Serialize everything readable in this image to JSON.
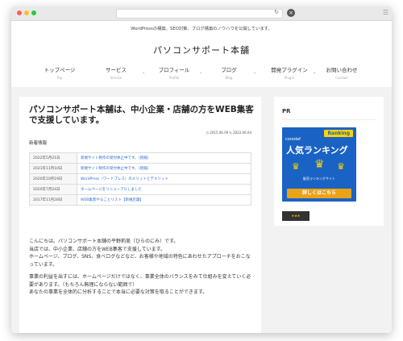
{
  "site": {
    "tagline": "WordPressの構築、SEO対策、ブログ構築のノウハウを公開しています。",
    "logo": "パソコンサポート本舗"
  },
  "nav": [
    {
      "jp": "トップページ",
      "en": "Top"
    },
    {
      "jp": "サービス",
      "en": "Service"
    },
    {
      "jp": "プロフィール",
      "en": "Profile"
    },
    {
      "jp": "ブログ",
      "en": "Blog"
    },
    {
      "jp": "開発プラグイン",
      "en": "Plugin"
    },
    {
      "jp": "お問い合わせ",
      "en": "Contact"
    }
  ],
  "post": {
    "title": "パソコンサポート本舗は、中小企業・店舗の方をWEB集客で支援しています。",
    "published": "2015.06.09",
    "updated": "2022.06.04",
    "news_label": "新着情報",
    "news": [
      {
        "date": "2022年5月21日",
        "title": "新規サイト制作の受付休止中です。（続報）"
      },
      {
        "date": "2021年11月10日",
        "title": "新規サイト制作の受付休止中です。（続報）"
      },
      {
        "date": "2020年10月19日",
        "title": "WordPress（ワードプレス）のメリットとデメリット"
      },
      {
        "date": "2020年7月24日",
        "title": "ホームページをリニューアルしました"
      },
      {
        "date": "2017年11月28日",
        "title": "WEB集客やることリスト【新規店舗】"
      }
    ],
    "paragraphs": [
      "こんにちは。パソコンサポート本舗の平野莉美（ひらのにみ）です。",
      "当店では、中小企業、店舗の方をWEB集客で支援しています。",
      "ホームページ、ブログ、SNS、食べログなどなど、お客様や地域の特色にあわせたアプローチをおこなっています。",
      "事業の利益を出すには、ホームページだけではなく、事業全体のバランスをみて仕組みを変えていく必要があります。（もちろん無理にならない範囲で）",
      "あなたの事業を全体的に分析することで本当に必要な対策を取ることができます。"
    ]
  },
  "sidebar": {
    "heading": "PR",
    "banner": {
      "brand": "coredaf",
      "badge": "Ranking",
      "title": "人気ランキング",
      "sub": "販売ランキングサイト",
      "button": "詳しくはこちら"
    }
  },
  "colors": {
    "accent": "#1a63c4",
    "link": "#2a6ad1",
    "gold": "#ffd400"
  }
}
